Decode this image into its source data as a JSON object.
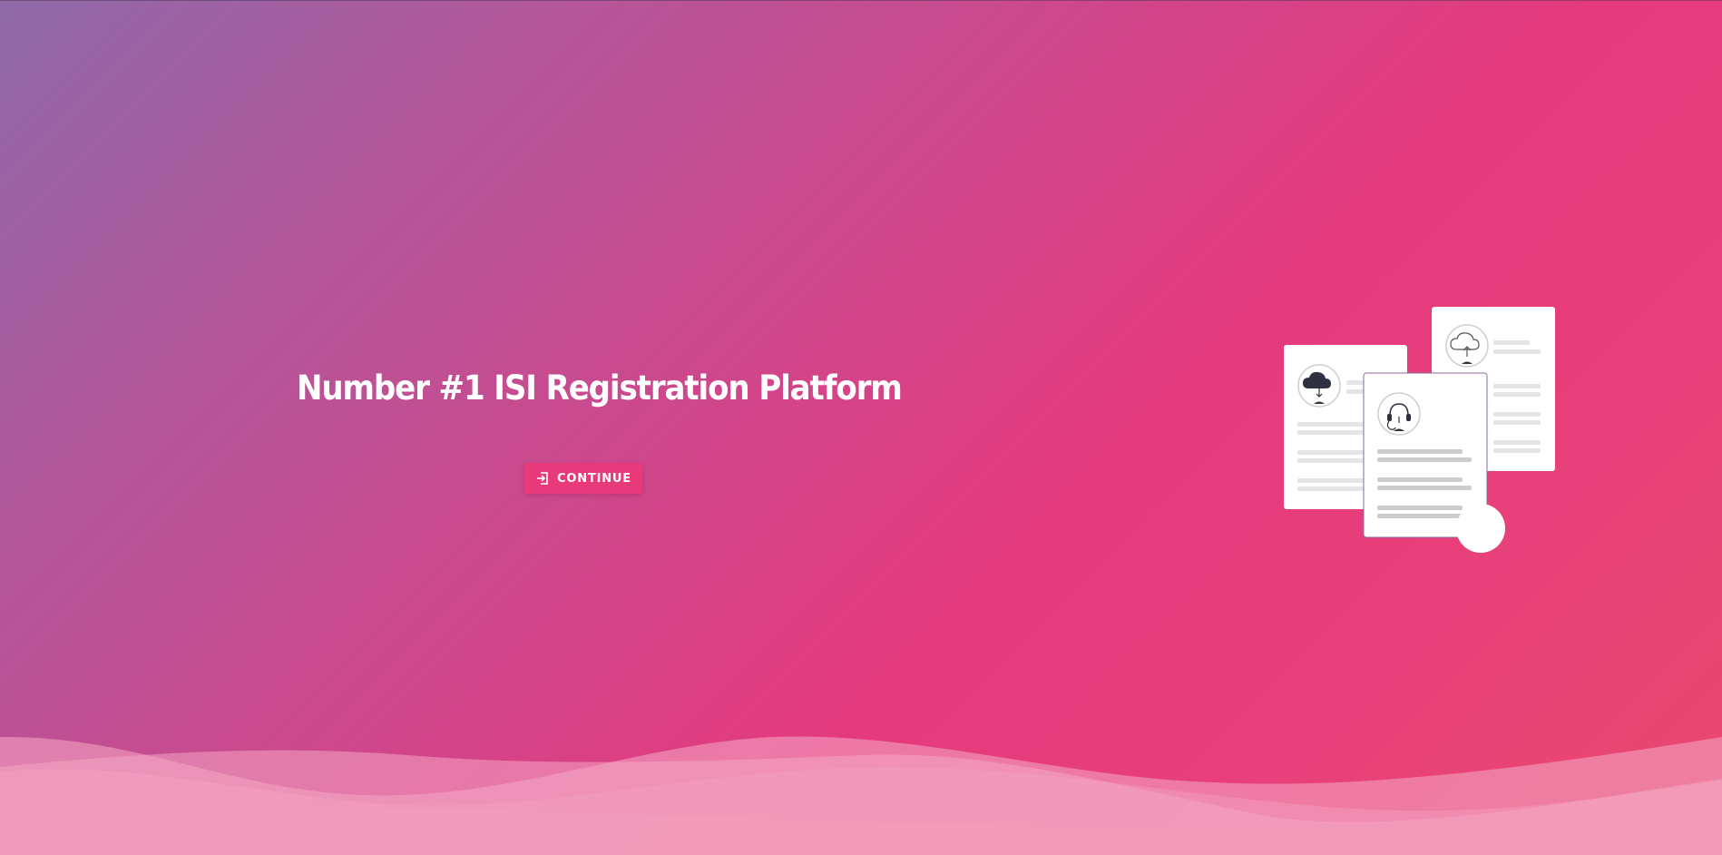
{
  "hero": {
    "title": "Number #1 ISI Registration Platform",
    "continue_label": "CONTINUE",
    "continue_icon": "sign-in-icon"
  },
  "illustration": {
    "icons": [
      "cloud-download-icon",
      "headset-icon",
      "cloud-upload-icon"
    ]
  },
  "colors": {
    "gradient_start": "#8f6aa8",
    "gradient_mid": "#e53a7c",
    "gradient_end": "#e84a6e",
    "button": "#e83a7a",
    "text": "#ffffff"
  }
}
